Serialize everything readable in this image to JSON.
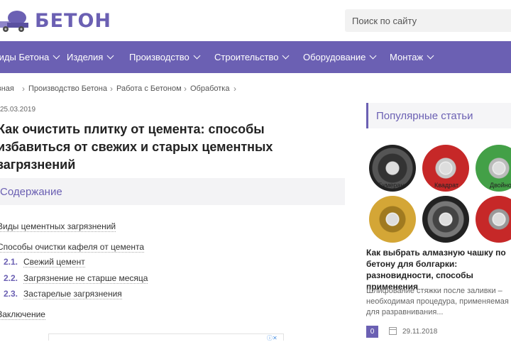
{
  "header": {
    "logo_text": "БЕТОН",
    "search_placeholder": "Поиск по сайту"
  },
  "nav": {
    "items": [
      {
        "label": "Виды Бетона"
      },
      {
        "label": "Изделия"
      },
      {
        "label": "Производство"
      },
      {
        "label": "Строительство"
      },
      {
        "label": "Оборудование"
      },
      {
        "label": "Монтаж"
      }
    ]
  },
  "breadcrumb": [
    "Главная",
    "Производство Бетона",
    "Работа с Бетоном",
    "Обработка"
  ],
  "article": {
    "date": "25.03.2019",
    "title": "Как очистить плитку от цемента: способы избавиться от свежих и старых цементных загрязнений"
  },
  "toc": {
    "heading": "Содержание",
    "items": [
      {
        "num": "",
        "label": "Виды цементных загрязнений"
      },
      {
        "num": "",
        "label": "Способы очистки кафеля от цемента"
      },
      {
        "num": "2.1.",
        "label": "Свежий цемент"
      },
      {
        "num": "2.2.",
        "label": "Загрязнение не старше месяца"
      },
      {
        "num": "2.3.",
        "label": "Застарелые загрязнения"
      },
      {
        "num": "",
        "label": "Заключение"
      }
    ]
  },
  "sidebar": {
    "heading": "Популярные статьи",
    "disc_labels": [
      "Бумеранг",
      "Квадрат",
      "Двойной"
    ],
    "post_title": "Как выбрать алмазную чашку по бетону для болгарки: разновидности, способы применения",
    "post_desc": "Шлифование стяжки после заливки – необходимая процедура, применяемая для разравнивания...",
    "comments": "0",
    "post_date": "29.11.2018"
  },
  "colors": {
    "accent": "#6b60b3"
  }
}
